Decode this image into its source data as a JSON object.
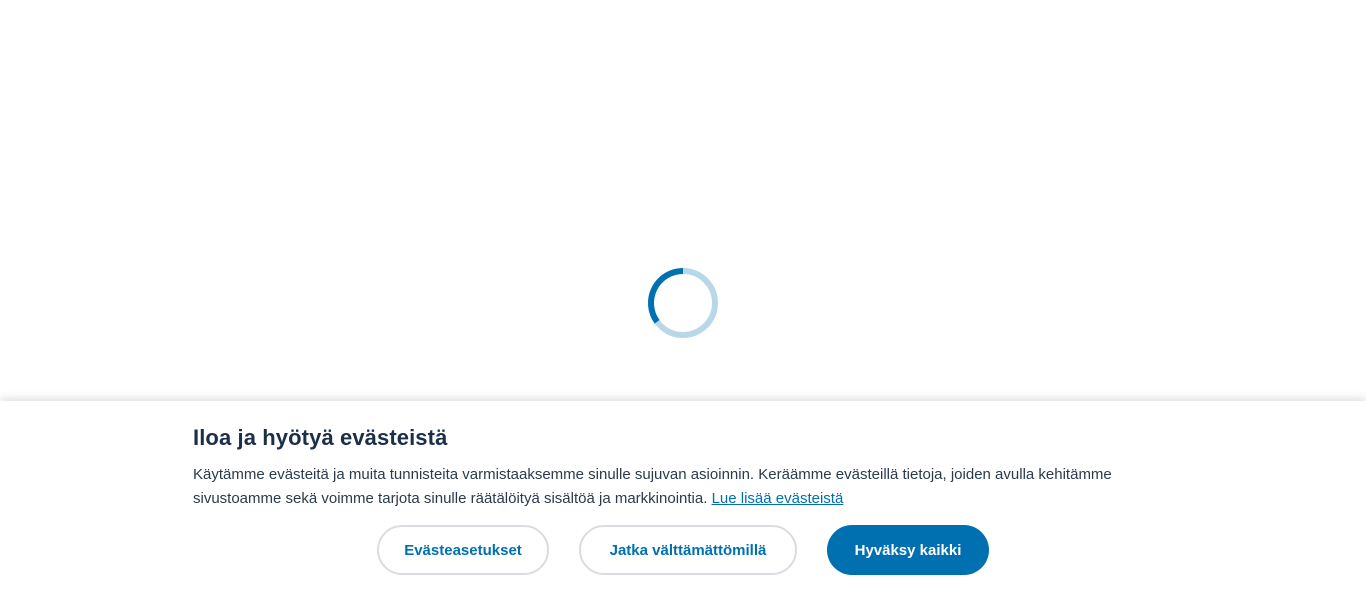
{
  "loader": {
    "state": "loading"
  },
  "cookie_banner": {
    "title": "Iloa ja hyötyä evästeistä",
    "text": "Käytämme evästeitä ja muita tunnisteita varmistaaksemme sinulle sujuvan asioinnin. Keräämme evästeillä tietoja, joiden avulla kehitämme sivustoamme sekä voimme tarjota sinulle räätälöityä sisältöä ja markkinointia.",
    "link_label": "Lue lisää evästeistä",
    "buttons": {
      "settings": "Evästeasetukset",
      "necessary_only": "Jatka välttämättömillä",
      "accept_all": "Hyväksy kaikki"
    }
  },
  "colors": {
    "accent": "#0070b0",
    "spinner_track": "#b8d8ea",
    "title": "#1b2e4a"
  }
}
